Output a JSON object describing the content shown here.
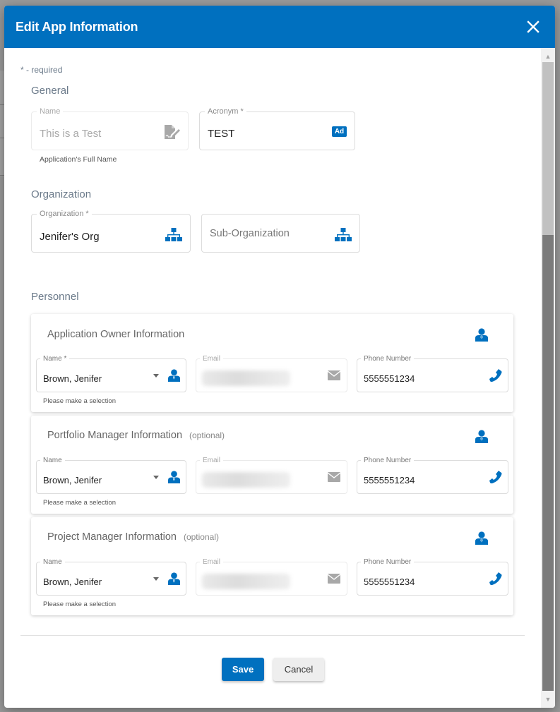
{
  "modal": {
    "title": "Edit App Information",
    "close_label": "✕",
    "required_note": "* - required"
  },
  "general": {
    "section_title": "General",
    "name_field": {
      "label": "Name",
      "value": "This is a Test",
      "hint": "Application's Full Name",
      "icon": "document-edit-icon",
      "disabled": true
    },
    "acronym_field": {
      "label": "Acronym *",
      "value": "TEST",
      "icon": "ad-badge-icon",
      "icon_text": "Ad"
    }
  },
  "organization": {
    "section_title": "Organization",
    "org_field": {
      "label": "Organization *",
      "value": "Jenifer's Org",
      "icon": "org-chart-icon"
    },
    "suborg_field": {
      "placeholder": "Sub-Organization",
      "icon": "org-chart-icon"
    }
  },
  "personnel": {
    "section_title": "Personnel",
    "cards": [
      {
        "title": "Application Owner Information",
        "optional": "",
        "name_label": "Name *",
        "name_value": "Brown, Jenifer",
        "email_label": "Email",
        "email_value": "",
        "phone_label": "Phone Number",
        "phone_value": "5555551234",
        "hint": "Please make a selection"
      },
      {
        "title": "Portfolio Manager Information",
        "optional": "(optional)",
        "name_label": "Name",
        "name_value": "Brown, Jenifer",
        "email_label": "Email",
        "email_value": "",
        "phone_label": "Phone Number",
        "phone_value": "5555551234",
        "hint": "Please make a selection"
      },
      {
        "title": "Project Manager Information",
        "optional": "(optional)",
        "name_label": "Name",
        "name_value": "Brown, Jenifer",
        "email_label": "Email",
        "email_value": "",
        "phone_label": "Phone Number",
        "phone_value": "5555551234",
        "hint": "Please make a selection"
      }
    ]
  },
  "footer": {
    "save_label": "Save",
    "cancel_label": "Cancel"
  },
  "colors": {
    "primary": "#0070bf",
    "section_text": "#6b7a8a",
    "disabled_icon": "#a8a8a8"
  }
}
